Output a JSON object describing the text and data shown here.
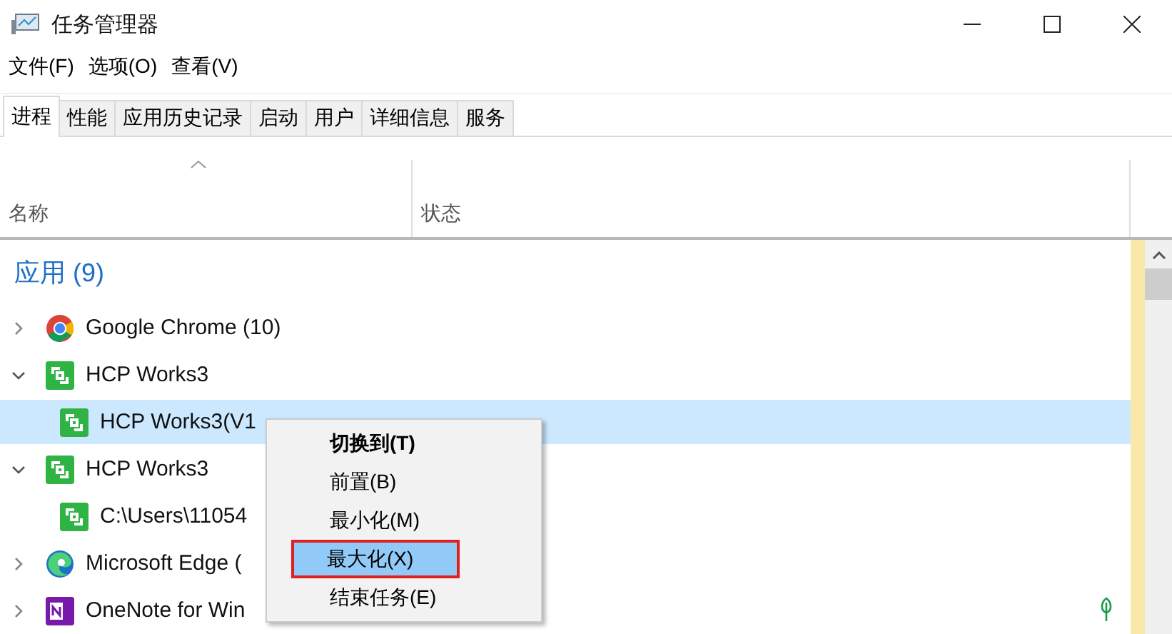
{
  "window": {
    "title": "任务管理器"
  },
  "menu_bar": [
    "文件(F)",
    "选项(O)",
    "查看(V)"
  ],
  "tabs": [
    {
      "label": "进程",
      "selected": true
    },
    {
      "label": "性能",
      "selected": false
    },
    {
      "label": "应用历史记录",
      "selected": false
    },
    {
      "label": "启动",
      "selected": false
    },
    {
      "label": "用户",
      "selected": false
    },
    {
      "label": "详细信息",
      "selected": false
    },
    {
      "label": "服务",
      "selected": false
    }
  ],
  "table": {
    "columns": [
      "名称",
      "状态"
    ],
    "group": "应用 (9)",
    "rows": [
      {
        "kind": "chrome",
        "name": "Google Chrome (10)",
        "expanded": false,
        "selected": false,
        "eco": false
      },
      {
        "kind": "hcp",
        "name": "HCP Works3",
        "expanded": true,
        "selected": false,
        "eco": false,
        "children": [
          {
            "kind": "hcp",
            "name": "HCP Works3(V1",
            "selected": true,
            "eco": false
          }
        ]
      },
      {
        "kind": "hcp",
        "name": "HCP Works3",
        "expanded": true,
        "selected": false,
        "eco": false,
        "children": [
          {
            "kind": "hcp",
            "name": "C:\\Users\\11054",
            "selected": false,
            "eco": false
          }
        ]
      },
      {
        "kind": "edge",
        "name": "Microsoft Edge (",
        "expanded": false,
        "selected": false,
        "eco": false
      },
      {
        "kind": "onenote",
        "name": "OneNote for Win",
        "expanded": false,
        "selected": false,
        "eco": true
      }
    ]
  },
  "context_menu": [
    {
      "label": "切换到(T)",
      "default": true,
      "selected": false,
      "marked": false
    },
    {
      "label": "前置(B)",
      "default": false,
      "selected": false,
      "marked": false
    },
    {
      "label": "最小化(M)",
      "default": false,
      "selected": false,
      "marked": false
    },
    {
      "label": "最大化(X)",
      "default": false,
      "selected": true,
      "marked": true
    },
    {
      "label": "结束任务(E)",
      "default": false,
      "selected": false,
      "marked": false
    }
  ]
}
